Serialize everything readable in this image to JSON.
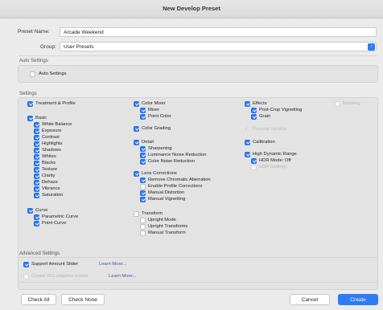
{
  "window": {
    "title": "New Develop Preset"
  },
  "preset_name": {
    "label": "Preset Name:",
    "value": "Arcade Weekend"
  },
  "group": {
    "label": "Group:",
    "value": "User Presets"
  },
  "auto_settings": {
    "title": "Auto Settings",
    "item": {
      "label": "Auto Settings",
      "checked": false
    }
  },
  "settings": {
    "title": "Settings",
    "col1": [
      {
        "label": "Treatment & Profile",
        "checked": true
      },
      {
        "label": "Basic",
        "checked": true
      },
      {
        "label": "White Balance",
        "checked": true
      },
      {
        "label": "Exposure",
        "checked": true
      },
      {
        "label": "Contrast",
        "checked": true
      },
      {
        "label": "Highlights",
        "checked": true
      },
      {
        "label": "Shadows",
        "checked": true
      },
      {
        "label": "Whites",
        "checked": true
      },
      {
        "label": "Blacks",
        "checked": true
      },
      {
        "label": "Texture",
        "checked": true
      },
      {
        "label": "Clarity",
        "checked": true
      },
      {
        "label": "Dehaze",
        "checked": true
      },
      {
        "label": "Vibrance",
        "checked": true
      },
      {
        "label": "Saturation",
        "checked": true
      },
      {
        "label": "Curve",
        "checked": true
      },
      {
        "label": "Parametric Curve",
        "checked": true
      },
      {
        "label": "Point Curve",
        "checked": true
      }
    ],
    "col2": [
      {
        "label": "Color Mixer",
        "checked": true
      },
      {
        "label": "Mixer",
        "checked": true
      },
      {
        "label": "Point Color",
        "checked": true
      },
      {
        "label": "Color Grading",
        "checked": true
      },
      {
        "label": "Detail",
        "checked": true
      },
      {
        "label": "Sharpening",
        "checked": true
      },
      {
        "label": "Luminance Noise Reduction",
        "checked": true
      },
      {
        "label": "Color Noise Reduction",
        "checked": true
      },
      {
        "label": "Lens Corrections",
        "checked": true
      },
      {
        "label": "Remove Chromatic Aberration",
        "checked": true
      },
      {
        "label": "Enable Profile Corrections",
        "checked": false
      },
      {
        "label": "Manual Distortion",
        "checked": true
      },
      {
        "label": "Manual Vignetting",
        "checked": true
      },
      {
        "label": "Transform",
        "checked": false
      },
      {
        "label": "Upright Mode",
        "checked": false
      },
      {
        "label": "Upright Transforms",
        "checked": false
      },
      {
        "label": "Manual Transform",
        "checked": false
      }
    ],
    "col3": [
      {
        "label": "Effects",
        "checked": true
      },
      {
        "label": "Post-Crop Vignetting",
        "checked": true
      },
      {
        "label": "Grain",
        "checked": true
      },
      {
        "label": "Process Version",
        "checked": true,
        "disabled": true
      },
      {
        "label": "Calibration",
        "checked": true
      },
      {
        "label": "High Dynamic Range",
        "checked": true
      },
      {
        "label": "HDR Mode: Off",
        "checked": true
      },
      {
        "label": "SDR Settings",
        "checked": false,
        "disabled": true
      }
    ],
    "col4": [
      {
        "label": "Masking",
        "checked": false,
        "disabled": true
      }
    ]
  },
  "advanced": {
    "title": "Advanced Settings",
    "support_amount": {
      "label": "Support Amount Slider",
      "checked": true,
      "link": "Learn More..."
    },
    "create_iso": {
      "label": "Create ISO adaptive preset",
      "checked": false,
      "disabled": true,
      "link": "Learn More..."
    }
  },
  "buttons": {
    "check_all": "Check All",
    "check_none": "Check None",
    "cancel": "Cancel",
    "create": "Create"
  },
  "colors": {
    "accent": "#2f7bf6"
  }
}
